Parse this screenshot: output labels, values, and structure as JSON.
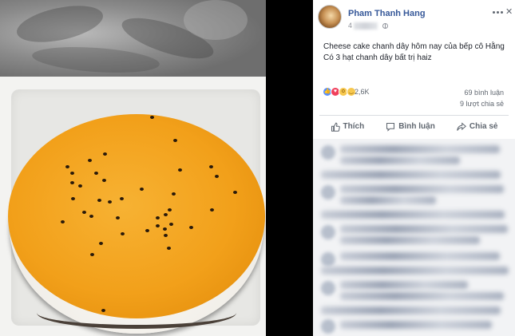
{
  "post": {
    "author_name": "Pham Thanh Hang",
    "time_prefix": "4",
    "text_lines": [
      "Cheese cake chanh dây hôm nay của bếp cô Hằng",
      "Có 3 hạt chanh dây bất trị haiz"
    ]
  },
  "stats": {
    "reactions_count": "2,6K",
    "comments_count": "69 bình luận",
    "shares_count": "9 lượt chia sẻ"
  },
  "actions": {
    "like_label": "Thích",
    "comment_label": "Bình luận",
    "share_label": "Chia sẻ"
  },
  "icons": {
    "reactions": [
      "like-icon",
      "love-icon",
      "wow-icon",
      "sad-icon"
    ],
    "privacy": "globe-icon",
    "more": "more-options-icon",
    "close": "close-icon"
  },
  "colors": {
    "author_link": "#365899",
    "text": "#1d2129",
    "secondary": "#606770",
    "like_blue": "#5890ff",
    "love_red": "#f0405c"
  }
}
